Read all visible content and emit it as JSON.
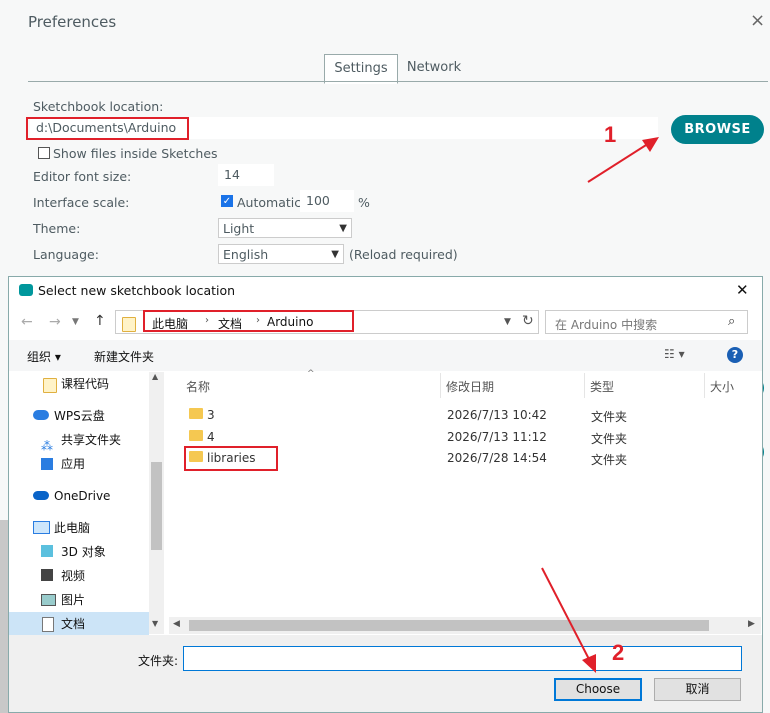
{
  "preferences": {
    "title": "Preferences",
    "close": "×",
    "tabs": [
      {
        "label": "Settings",
        "active": true
      },
      {
        "label": "Network",
        "active": false
      }
    ],
    "sketchbook_label": "Sketchbook location:",
    "sketchbook_value": "d:\\Documents\\Arduino",
    "browse_label": "BROWSE",
    "show_files_label": "Show files inside Sketches",
    "font_size_label": "Editor font size:",
    "font_size_value": "14",
    "scale_label": "Interface scale:",
    "scale_auto_label": "Automatic",
    "scale_value": "100",
    "scale_unit": "%",
    "theme_label": "Theme:",
    "theme_value": "Light",
    "language_label": "Language:",
    "language_value": "English",
    "language_note": "(Reload required)",
    "accent_color": "#00818c"
  },
  "annotations": {
    "step1": "1",
    "step2": "2",
    "color": "#e0202a"
  },
  "dialog": {
    "title": "Select new sketchbook location",
    "close": "✕",
    "breadcrumb": [
      "此电脑",
      "文档",
      "Arduino"
    ],
    "search_placeholder": "在 Arduino 中搜索",
    "organize_label": "组织 ▾",
    "new_folder_label": "新建文件夹",
    "help": "?",
    "nav": [
      {
        "label": "课程代码",
        "icon": "folder-icon"
      },
      {
        "label": "WPS云盘",
        "icon": "cloud-icon"
      },
      {
        "label": "共享文件夹",
        "icon": "share-icon"
      },
      {
        "label": "应用",
        "icon": "apps-icon"
      },
      {
        "label": "OneDrive",
        "icon": "onedrive-icon"
      },
      {
        "label": "此电脑",
        "icon": "computer-icon"
      },
      {
        "label": "3D 对象",
        "icon": "cube-icon"
      },
      {
        "label": "视频",
        "icon": "video-icon"
      },
      {
        "label": "图片",
        "icon": "picture-icon"
      },
      {
        "label": "文档",
        "icon": "document-icon",
        "selected": true
      }
    ],
    "columns": {
      "name": "名称",
      "date": "修改日期",
      "type": "类型",
      "size": "大小"
    },
    "rows": [
      {
        "name": "3",
        "date": "2026/7/13 10:42",
        "type": "文件夹"
      },
      {
        "name": "4",
        "date": "2026/7/13 11:12",
        "type": "文件夹"
      },
      {
        "name": "libraries",
        "date": "2026/7/28 14:54",
        "type": "文件夹"
      }
    ],
    "folder_label": "文件夹:",
    "folder_value": "",
    "choose_label": "Choose",
    "cancel_label": "取消"
  }
}
